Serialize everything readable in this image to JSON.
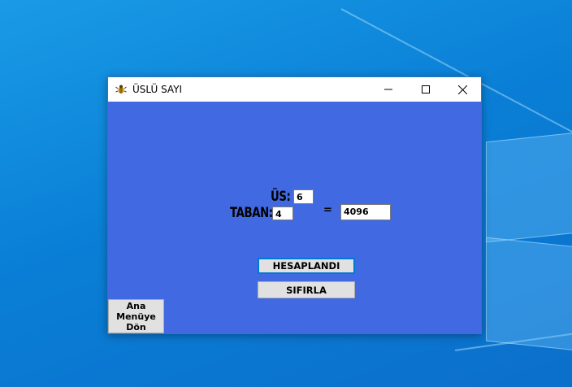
{
  "window": {
    "title": "ÜSLÜ SAYI",
    "icon": "bug-app-icon"
  },
  "caption_buttons": {
    "minimize": "minimize-icon",
    "maximize": "maximize-icon",
    "close": "close-icon"
  },
  "form": {
    "us_label": "ÜS:",
    "us_value": "6",
    "taban_label": "TABAN:",
    "taban_value": "4",
    "equals": "=",
    "result_value": "4096"
  },
  "buttons": {
    "calculate": "HESAPLANDI",
    "reset": "SIFIRLA",
    "menu_line1": "Ana",
    "menu_line2": "Menüye",
    "menu_line3": "Dön"
  },
  "colors": {
    "client_background": "#4169e1",
    "desktop_background": "#0a7fd6",
    "focus_border": "#0078d7"
  }
}
